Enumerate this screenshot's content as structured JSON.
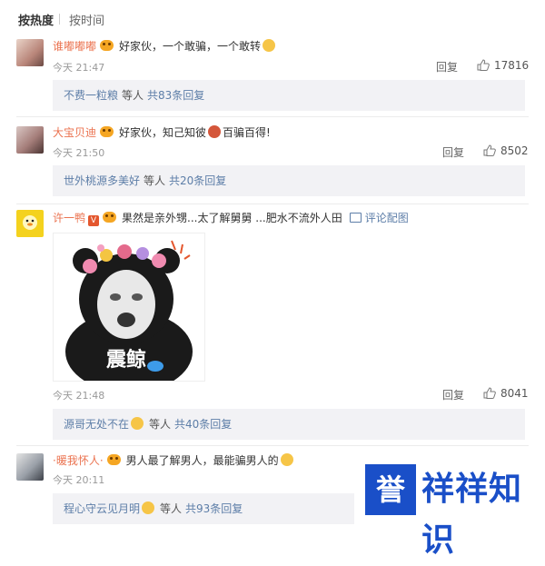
{
  "sort": {
    "hot": "按热度",
    "time": "按时间"
  },
  "comments": [
    {
      "user": "谁嘟嘟嘟",
      "text": "好家伙，一个敢骗，一个敢转",
      "time": "今天 21:47",
      "reply": "回复",
      "likes": "17816",
      "sub": {
        "name": "不费一粒粮",
        "etc": "等人",
        "count": "共83条回复"
      }
    },
    {
      "user": "大宝贝迪",
      "text_a": "好家伙，知己知彼",
      "text_b": "百骗百得!",
      "time": "今天 21:50",
      "reply": "回复",
      "likes": "8502",
      "sub": {
        "name": "世外桃源多美好",
        "etc": "等人",
        "count": "共20条回复"
      }
    },
    {
      "user": "许一鸭",
      "text": "果然是亲外甥...太了解舅舅 ...肥水不流外人田",
      "pic_link": "评论配图",
      "meme_caption": "震鲸",
      "time": "今天 21:48",
      "reply": "回复",
      "likes": "8041",
      "sub": {
        "name": "源哥无处不在",
        "etc": "等人",
        "count": "共40条回复"
      }
    },
    {
      "user": "·暖我怀人·",
      "text": "男人最了解男人，最能骗男人的",
      "time": "今天 20:11",
      "sub": {
        "name": "程心守云见月明",
        "etc": "等人",
        "count": "共93条回复"
      }
    }
  ],
  "watermark": {
    "icon": "誉",
    "text": "祥祥知识"
  },
  "colors": {
    "username": "#eb7350",
    "link": "#5d7ea8",
    "brand": "#1a4fc8"
  }
}
